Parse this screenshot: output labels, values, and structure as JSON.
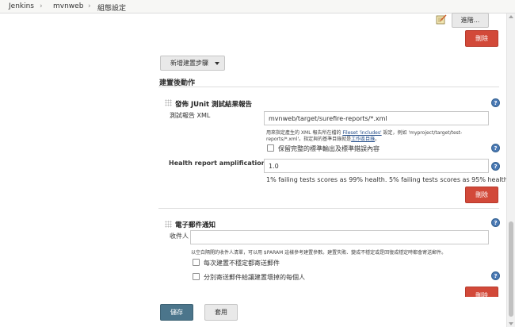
{
  "breadcrumb": {
    "items": [
      "Jenkins",
      "mvnweb",
      "組態設定"
    ],
    "separator": "›"
  },
  "top": {
    "advanced_button": "進階...",
    "delete_button": "刪除"
  },
  "build_steps": {
    "add_step_button": "新增建置步驟",
    "post_build_heading": "建置後動作"
  },
  "junit": {
    "title": "發佈 JUnit 測試結果報告",
    "xml_label": "測試報告 XML",
    "xml_value": "mvnweb/target/surefire-reports/*.xml",
    "hint_line1_pre": "用來指定產生的 XML 報告所在檔的 ",
    "hint_link1": "Fileset 'includes'",
    "hint_line1_post": " 設定，例如 'myproject/target/test-",
    "hint_line2_pre": "reports/*.xml'。指定與的基準目錄就是",
    "hint_link2": "工作區目錄",
    "hint_line2_post": "。",
    "keep_output_label": "保留完整的標準輸出及標準錯誤內容",
    "health_label": "Health report amplification factor",
    "health_value": "1.0",
    "health_hint": "1% failing tests scores as 99% health. 5% failing tests scores as 95% health",
    "delete_button": "刪除"
  },
  "email": {
    "title": "電子郵件通知",
    "recipients_label": "收件人",
    "recipients_value": "",
    "hint": "以空白隔開的收件人清單，可以用 $PARAM 這樣參考建置參數。建置失敗、變成不穩定或是回復成穩定時都會寄送郵件。",
    "option1_label": "每次建置不穩定都寄送郵件",
    "option2_label": "分別寄送郵件給讓建置壞掉的每個人",
    "delete_button": "刪除"
  },
  "footer": {
    "save_button": "儲存",
    "apply_button": "套用"
  },
  "colors": {
    "danger": "#d24939",
    "primary": "#4b758b",
    "help": "#4b7ab5"
  },
  "icons": {
    "notepad": "notepad-icon",
    "help": "help-icon",
    "grip": "drag-handle-icon",
    "dropdown": "caret-down-icon"
  }
}
